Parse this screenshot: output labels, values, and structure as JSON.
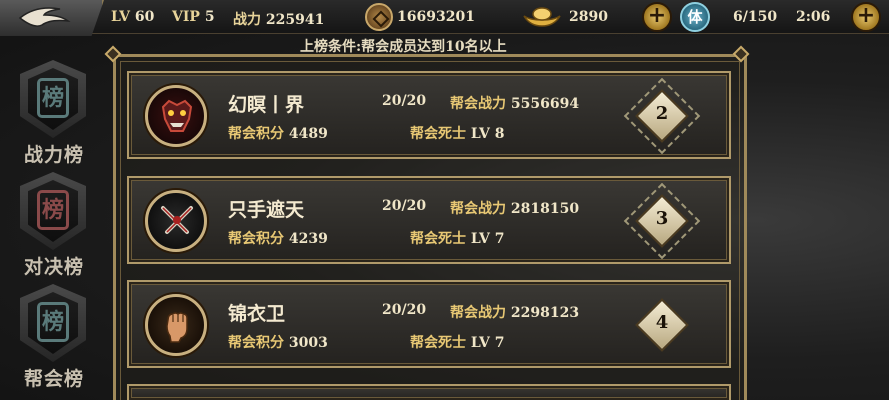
{
  "topbar": {
    "level_label": "LV",
    "level": "60",
    "vip_label": "VIP",
    "vip": "5",
    "power_label": "战力",
    "power": "225941",
    "coins": "16693201",
    "ingots": "2890",
    "stamina_icon_char": "体",
    "stamina": "6/150",
    "timer": "2:06",
    "plus": "+"
  },
  "condition_text": "上榜条件:帮会成员达到10名以上",
  "tabs": [
    {
      "label": "战力榜",
      "seal": "榜"
    },
    {
      "label": "对决榜",
      "seal": "榜"
    },
    {
      "label": "帮会榜",
      "seal": "榜"
    }
  ],
  "labels": {
    "guild_power": "帮会战力",
    "guild_score": "帮会积分",
    "death_soldier": "帮会死士",
    "lv": "LV"
  },
  "guilds": [
    {
      "name": "幻瞑丨界",
      "members": "20/20",
      "power": "5556694",
      "score": "4489",
      "death_lv": "8",
      "rank": "2",
      "portrait_icon": "demon-mask-icon"
    },
    {
      "name": "只手遮天",
      "members": "20/20",
      "power": "2818150",
      "score": "4239",
      "death_lv": "7",
      "rank": "3",
      "portrait_icon": "crossed-swords-icon"
    },
    {
      "name": "锦衣卫",
      "members": "20/20",
      "power": "2298123",
      "score": "3003",
      "death_lv": "7",
      "rank": "4",
      "portrait_icon": "raised-fist-icon"
    }
  ],
  "colors": {
    "gold_border": "#b09a6a",
    "label_gold": "#e8c874",
    "text_light": "#f0e6c8"
  }
}
